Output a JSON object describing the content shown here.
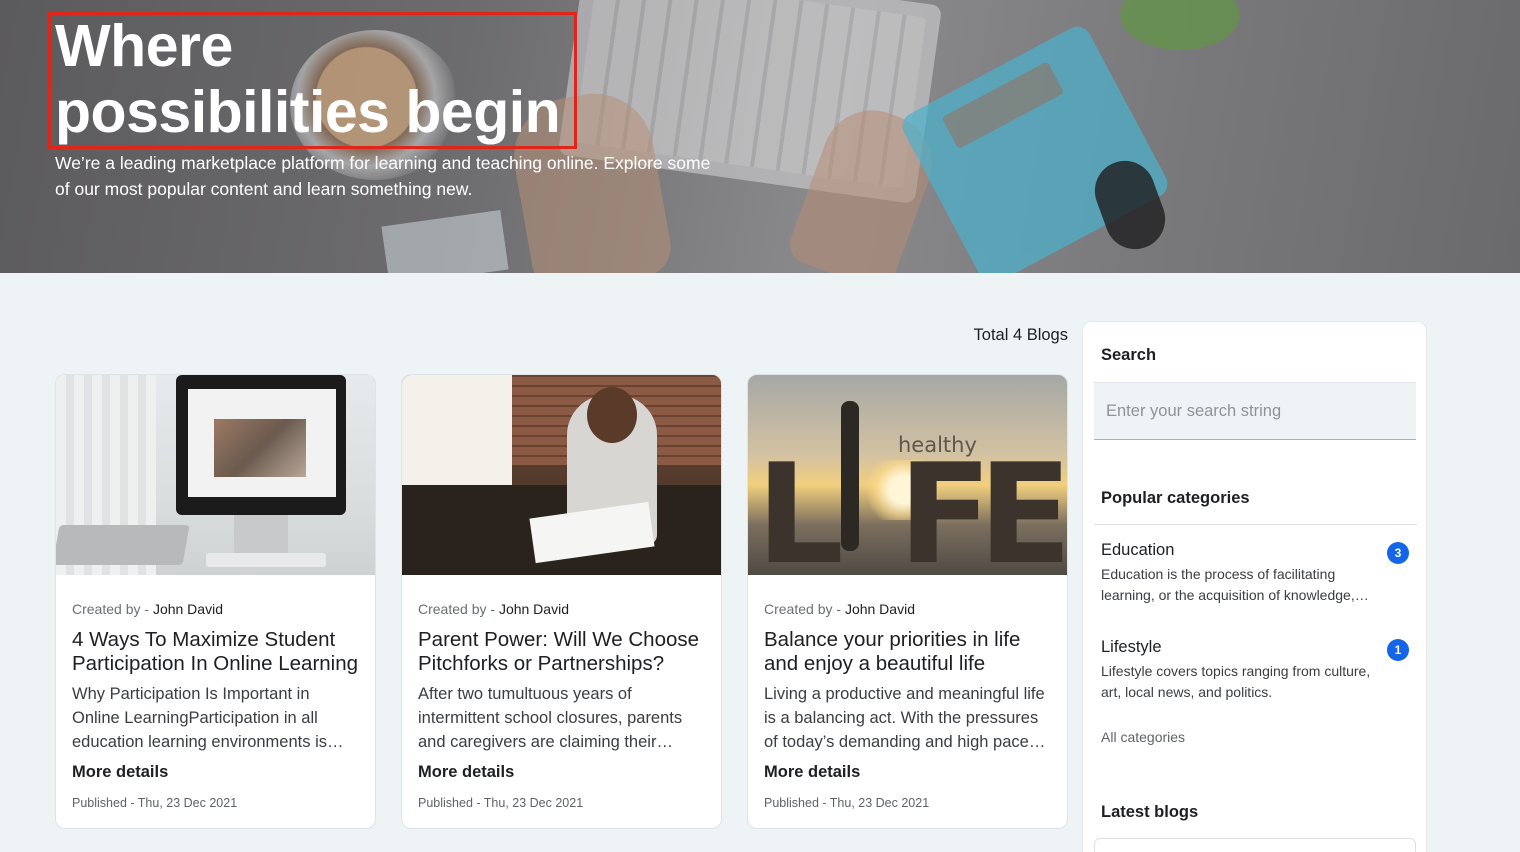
{
  "hero": {
    "title": "Where possibilities begin",
    "subtitle": "We’re a leading marketplace platform for learning and teaching online. Explore some of our most popular content and learn something new."
  },
  "blogs": {
    "total_label": "Total 4 Blogs",
    "items": [
      {
        "created_prefix": "Created by - ",
        "author": "John David",
        "title": "4 Ways To Maximize Student Participation In Online Learning",
        "excerpt": "Why Participation Is Important in Online LearningParticipation in all education learning environments is…",
        "more": "More details",
        "published": "Published - Thu, 23 Dec 2021"
      },
      {
        "created_prefix": "Created by - ",
        "author": "John David",
        "title": "Parent Power: Will We Choose Pitchforks or Partnerships?",
        "excerpt": "After two tumultuous years of intermittent school closures, parents and caregivers are claiming their…",
        "more": "More details",
        "published": "Published - Thu, 23 Dec 2021"
      },
      {
        "created_prefix": "Created by - ",
        "author": "John David",
        "title": "Balance your priorities in life and enjoy a beautiful life",
        "excerpt": "Living a productive and meaningful life is a balancing act. With the pressures of today’s demanding and high pace…",
        "more": "More details",
        "published": "Published - Thu, 23 Dec 2021"
      }
    ],
    "thumb3": {
      "small_word": "healthy",
      "big_letters": [
        "L",
        "F",
        "E"
      ]
    }
  },
  "sidebar": {
    "search_heading": "Search",
    "search_placeholder": "Enter your search string",
    "categories_heading": "Popular categories",
    "categories": [
      {
        "name": "Education",
        "count": "3",
        "desc": "Education is the process of facilitating learning, or the acquisition of knowledge,…"
      },
      {
        "name": "Lifestyle",
        "count": "1",
        "desc": "Lifestyle covers topics ranging from culture, art, local news, and politics."
      }
    ],
    "all_categories": "All categories",
    "latest_heading": "Latest blogs"
  },
  "colors": {
    "badge": "#1565e8",
    "highlight_box": "#e0251b",
    "page_bg": "#eef3f6"
  }
}
